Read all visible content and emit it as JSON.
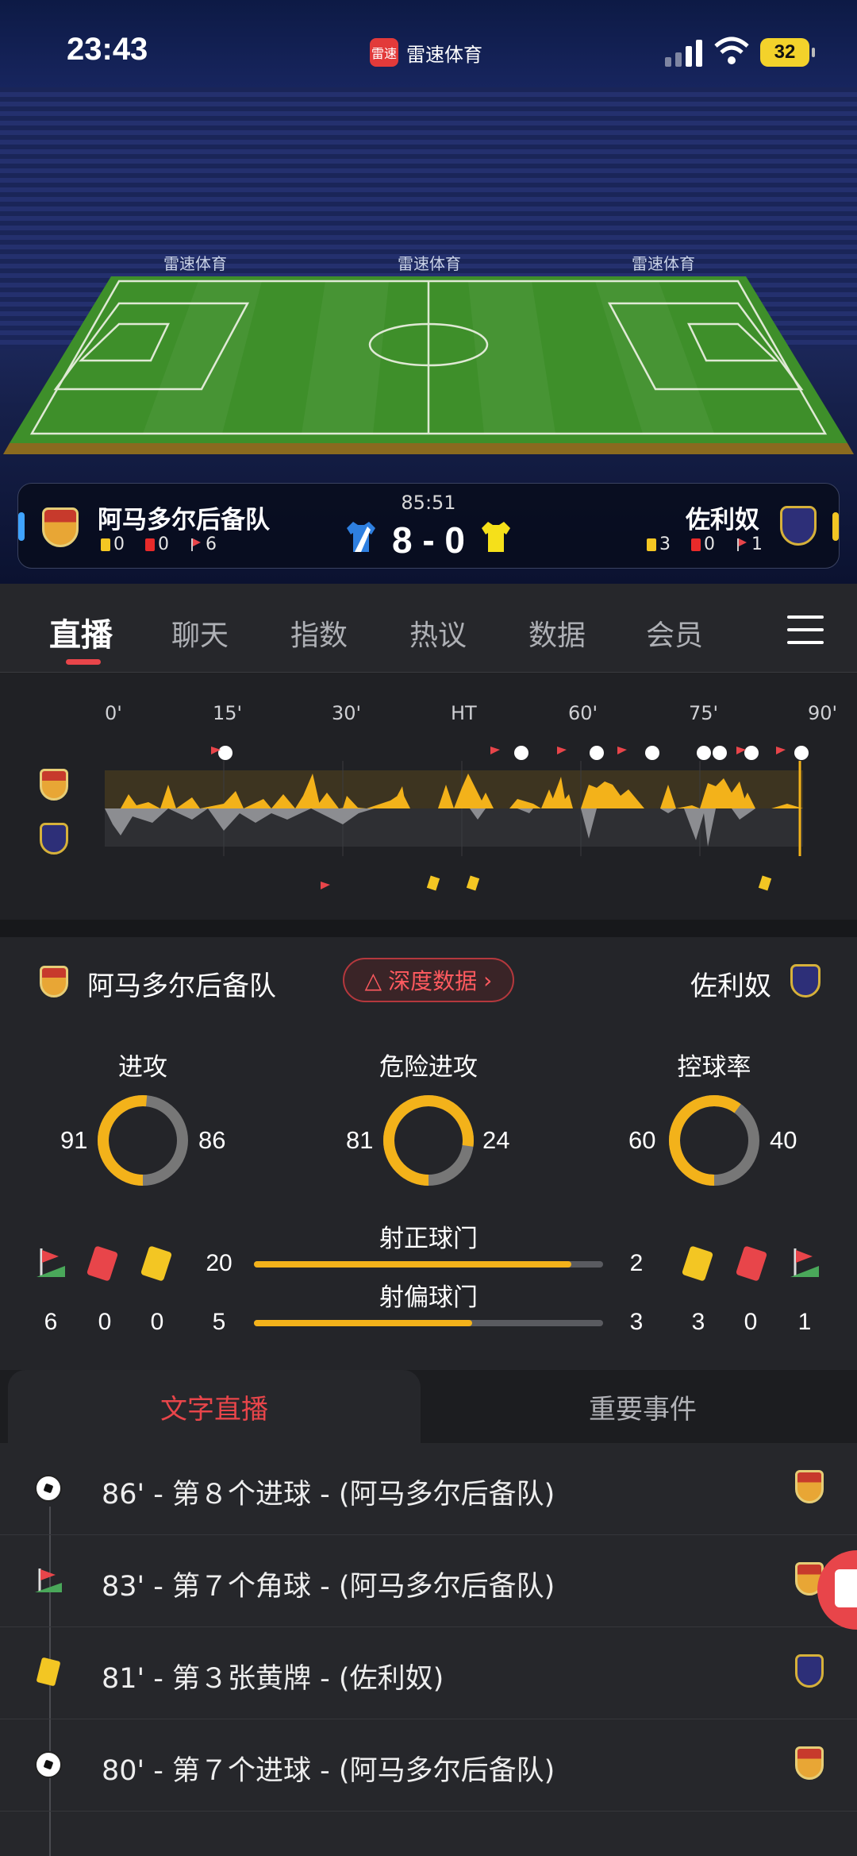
{
  "status_bar": {
    "time": "23:43",
    "app_name": "雷速体育",
    "app_logo_text": "雷速",
    "battery": "32"
  },
  "stadium": {
    "sponsor_boards": [
      "雷速体育",
      "雷速体育",
      "雷速体育"
    ]
  },
  "match": {
    "clock": "85:51",
    "score": "8 - 0",
    "home": {
      "name": "阿马多尔后备队",
      "yellow": "0",
      "red": "0",
      "corners": "6",
      "color": "#3fa3ff"
    },
    "away": {
      "name": "佐利奴",
      "yellow": "3",
      "red": "0",
      "corners": "1",
      "color": "#f3c623"
    }
  },
  "tabs": {
    "items": [
      "直播",
      "聊天",
      "指数",
      "热议",
      "数据",
      "会员"
    ],
    "active": "直播"
  },
  "timeline": {
    "labels": [
      "0'",
      "15'",
      "30'",
      "HT",
      "60'",
      "75'",
      "90'"
    ]
  },
  "stats": {
    "home_name": "阿马多尔后备队",
    "away_name": "佐利奴",
    "deep_data_label": "深度数据",
    "donuts": [
      {
        "label": "进攻",
        "home": "91",
        "away": "86",
        "home_share": 0.514
      },
      {
        "label": "危险进攻",
        "home": "81",
        "away": "24",
        "home_share": 0.771
      },
      {
        "label": "控球率",
        "home": "60",
        "away": "40",
        "home_share": 0.6
      }
    ],
    "bars": [
      {
        "label": "射正球门",
        "home": "20",
        "away": "2",
        "home_share": 0.909
      },
      {
        "label": "射偏球门",
        "home": "5",
        "away": "3",
        "home_share": 0.625
      }
    ],
    "home_counts": {
      "corners": "6",
      "red": "0",
      "yellow": "0"
    },
    "away_counts": {
      "yellow": "3",
      "red": "0",
      "corners": "1"
    }
  },
  "lower_tabs": {
    "active": "文字直播",
    "inactive": "重要事件"
  },
  "events": [
    {
      "icon": "ball-icon",
      "text": "86' - 第８个进球 - (阿马多尔后备队)",
      "team": "home"
    },
    {
      "icon": "corner-flag-icon",
      "text": "83' - 第７个角球 - (阿马多尔后备队)",
      "team": "home"
    },
    {
      "icon": "yellow-card-icon",
      "text": "81' - 第３张黄牌 - (佐利奴)",
      "team": "away"
    },
    {
      "icon": "ball-icon",
      "text": "80' - 第７个进球 - (阿马多尔后备队)",
      "team": "home"
    }
  ]
}
